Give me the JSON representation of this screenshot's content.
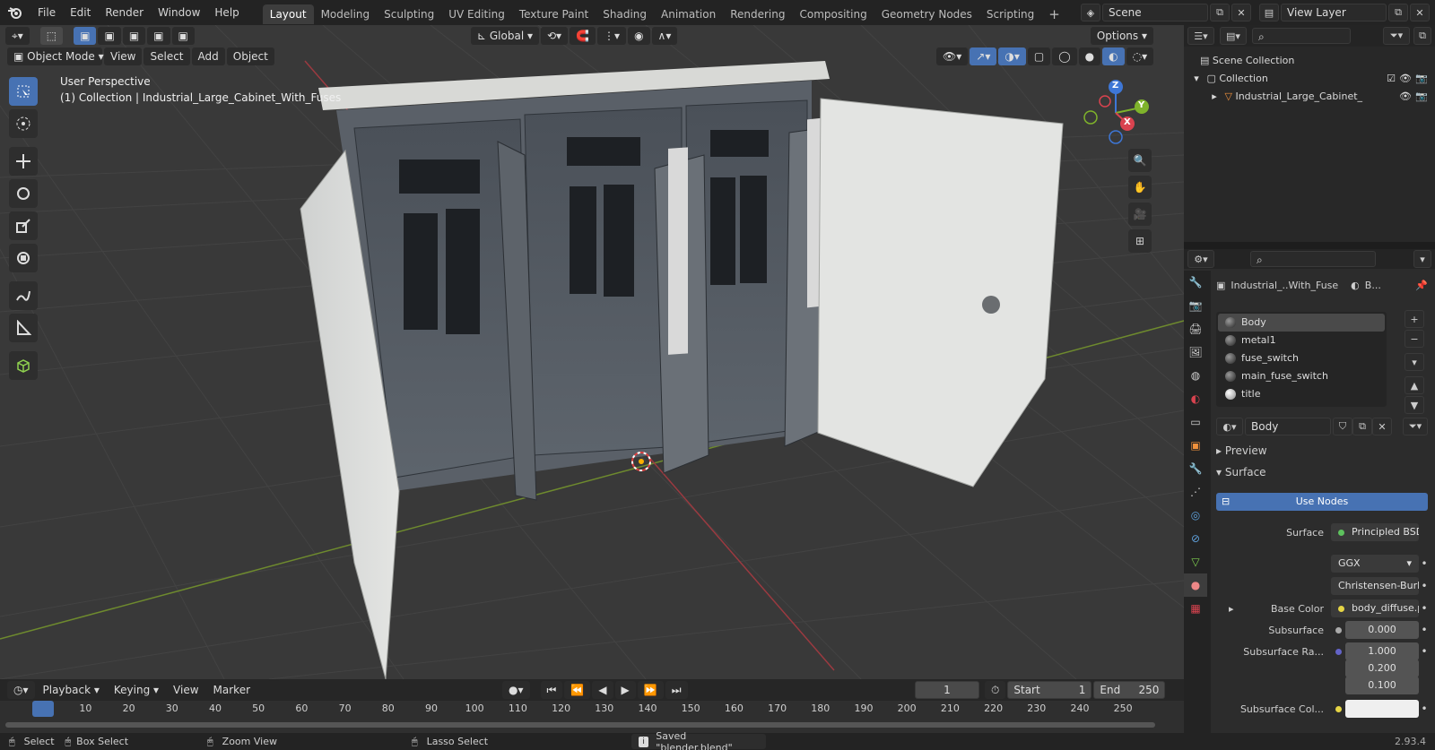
{
  "topbar": {
    "menus": [
      "File",
      "Edit",
      "Render",
      "Window",
      "Help"
    ],
    "workspaces": [
      "Layout",
      "Modeling",
      "Sculpting",
      "UV Editing",
      "Texture Paint",
      "Shading",
      "Animation",
      "Rendering",
      "Compositing",
      "Geometry Nodes",
      "Scripting"
    ],
    "active_workspace": "Layout",
    "scene": "Scene",
    "view_layer": "View Layer"
  },
  "viewport": {
    "orientation": "Global",
    "options": "Options",
    "mode": "Object Mode",
    "menus": [
      "View",
      "Select",
      "Add",
      "Object"
    ],
    "perspective": "User Perspective",
    "collection_info": "(1) Collection | Industrial_Large_Cabinet_With_Fuses",
    "gizmo": {
      "z": "Z",
      "y": "Y",
      "x": "X"
    }
  },
  "outliner": {
    "search_placeholder": "",
    "scene_collection": "Scene Collection",
    "collection": "Collection",
    "object": "Industrial_Large_Cabinet_"
  },
  "properties": {
    "object_name": "Industrial_..With_Fuse",
    "data_short": "B...",
    "materials": [
      "Body",
      "metal1",
      "fuse_switch",
      "main_fuse_switch",
      "title"
    ],
    "selected_material": "Body",
    "material_name": "Body",
    "sections": {
      "preview": "Preview",
      "surface": "Surface"
    },
    "use_nodes": "Use Nodes",
    "surface": {
      "label": "Surface",
      "value": "Principled BSDF"
    },
    "distribution": "GGX",
    "subsurface_method": "Christensen-Burley",
    "base_color": {
      "label": "Base Color",
      "value": "body_diffuse.png"
    },
    "subsurface": {
      "label": "Subsurface",
      "value": "0.000"
    },
    "subsurface_radius": {
      "label": "Subsurface Ra...",
      "values": [
        "1.000",
        "0.200",
        "0.100"
      ]
    },
    "subsurface_color": {
      "label": "Subsurface Col..."
    }
  },
  "timeline": {
    "menus": [
      "Playback",
      "Keying",
      "View",
      "Marker"
    ],
    "current_frame": "1",
    "start_label": "Start",
    "start": "1",
    "end_label": "End",
    "end": "250",
    "ticks": [
      "1",
      "10",
      "20",
      "30",
      "40",
      "50",
      "60",
      "70",
      "80",
      "90",
      "100",
      "110",
      "120",
      "130",
      "140",
      "150",
      "160",
      "170",
      "180",
      "190",
      "200",
      "210",
      "220",
      "230",
      "240",
      "250"
    ]
  },
  "statusbar": {
    "select": "Select",
    "box_select": "Box Select",
    "zoom_view": "Zoom View",
    "lasso_select": "Lasso Select",
    "message": "Saved \"blender.blend\"",
    "version": "2.93.4"
  },
  "colors": {
    "accent": "#4772b3",
    "x_axis": "#d9434f",
    "y_axis": "#7fb32b",
    "z_axis": "#3e77d6",
    "viewport_bg": "#393939"
  }
}
